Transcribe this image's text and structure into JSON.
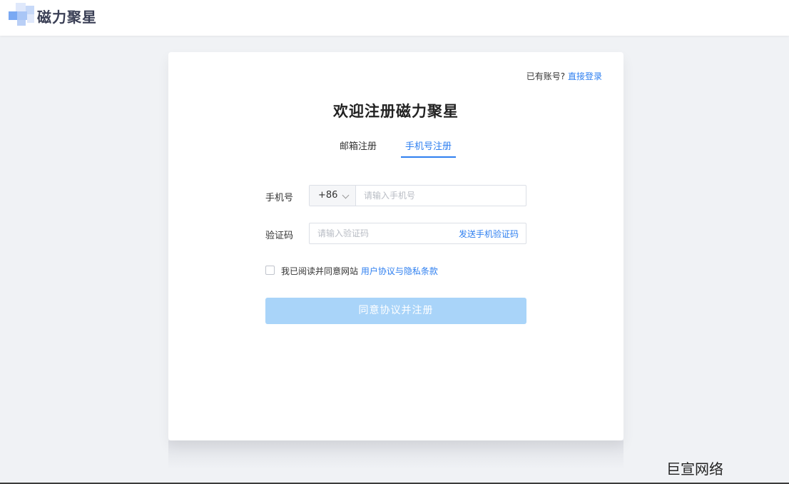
{
  "app": {
    "brand": "磁力聚星",
    "brand_colors": [
      "#7aa9f3",
      "#b9cff6",
      "#dfe8fb"
    ]
  },
  "card": {
    "login_prompt": "已有账号?",
    "login_link": "直接登录",
    "title": "欢迎注册磁力聚星",
    "tabs": [
      {
        "label": "邮箱注册",
        "active": false
      },
      {
        "label": "手机号注册",
        "active": true
      }
    ],
    "phone": {
      "label": "手机号",
      "country_code": "+86",
      "placeholder": "请输入手机号"
    },
    "code": {
      "label": "验证码",
      "placeholder": "请输入验证码",
      "send_label": "发送手机验证码"
    },
    "agreement": {
      "checked": false,
      "text": "我已阅读并同意网站",
      "link": "用户协议与隐私条款"
    },
    "submit_label": "同意协议并注册"
  },
  "colors": {
    "accent": "#2e7ff0",
    "submit_disabled": "#a9d4f9",
    "page_bg": "#f0f2f5"
  },
  "watermark": "巨宣网络"
}
